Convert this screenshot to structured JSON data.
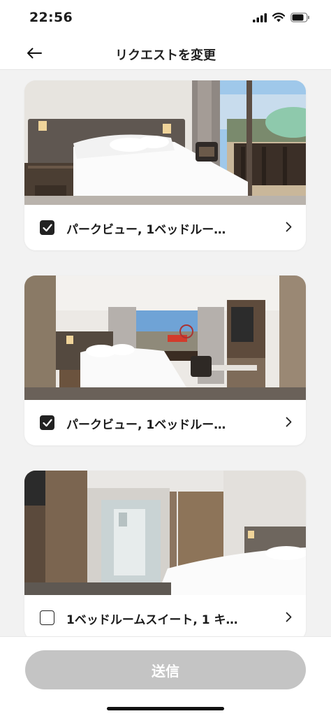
{
  "status_bar": {
    "time": "22:56"
  },
  "header": {
    "title": "リクエストを変更"
  },
  "rooms": [
    {
      "name": "パークビュー, 1ベッドルー…",
      "checked": true
    },
    {
      "name": "パークビュー, 1ベッドルー…",
      "checked": true
    },
    {
      "name": "1ベッドルームスイート, 1 キ…",
      "checked": false
    }
  ],
  "footer": {
    "submit_label": "送信"
  }
}
